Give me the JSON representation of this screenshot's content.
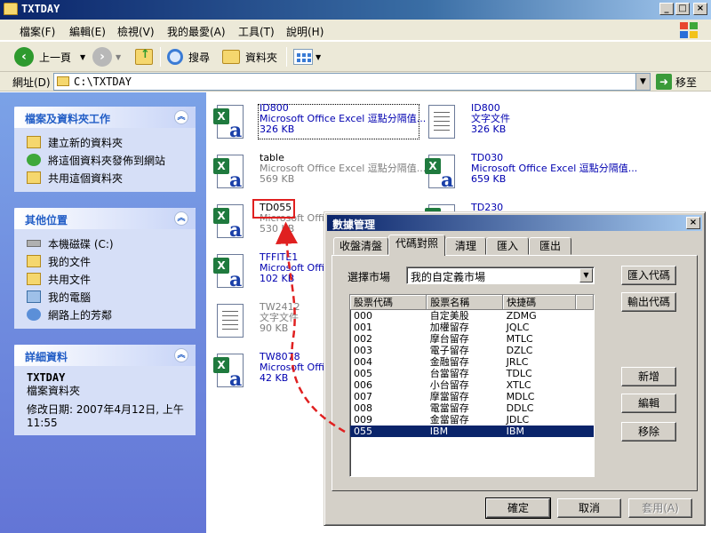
{
  "window": {
    "title": "TXTDAY"
  },
  "menu": [
    "檔案(F)",
    "編輯(E)",
    "檢視(V)",
    "我的最愛(A)",
    "工具(T)",
    "說明(H)"
  ],
  "toolbar": {
    "back": "上一頁",
    "search": "搜尋",
    "folders": "資料夾"
  },
  "address": {
    "label": "網址(D)",
    "value": "C:\\TXTDAY",
    "go": "移至"
  },
  "taskpane": {
    "file_tasks": {
      "title": "檔案及資料夾工作",
      "items": [
        "建立新的資料夾",
        "將這個資料夾發佈到網站",
        "共用這個資料夾"
      ]
    },
    "other_places": {
      "title": "其他位置",
      "items": [
        "本機磁碟 (C:)",
        "我的文件",
        "共用文件",
        "我的電腦",
        "網路上的芳鄰"
      ]
    },
    "details": {
      "title": "詳細資料",
      "name": "TXTDAY",
      "type": "檔案資料夾",
      "modified": "修改日期: 2007年4月12日, 上午 11:55"
    }
  },
  "files": [
    {
      "name": "ID800",
      "type": "Microsoft Office Excel 逗點分隔值...",
      "size": "326 KB",
      "kind": "excel"
    },
    {
      "name": "ID800",
      "type": "文字文件",
      "size": "326 KB",
      "kind": "text"
    },
    {
      "name": "table",
      "type": "Microsoft Office Excel 逗點分隔值...",
      "size": "569 KB",
      "kind": "excel"
    },
    {
      "name": "TD030",
      "type": "Microsoft Office Excel 逗點分隔值...",
      "size": "659 KB",
      "kind": "excel"
    },
    {
      "name": "TD055",
      "type": "Microsoft Office Excel 逗點分隔值...",
      "size": "530 KB",
      "kind": "excel"
    },
    {
      "name": "TD230",
      "type": "",
      "size": "",
      "kind": "excel"
    },
    {
      "name": "TFFITE1",
      "type": "Microsoft Office Excel 逗點分隔值...",
      "size": "102 KB",
      "kind": "excel"
    },
    {
      "name": "TW2412",
      "type": "文字文件",
      "size": "90 KB",
      "kind": "text"
    },
    {
      "name": "TW8078",
      "type": "Microsoft Office Excel 逗點分隔值...",
      "size": "42 KB",
      "kind": "excel"
    }
  ],
  "dialog": {
    "title": "數據管理",
    "tabs": [
      "收盤清盤",
      "代碼對照",
      "清理",
      "匯入",
      "匯出"
    ],
    "active_tab": 1,
    "market_label": "選擇市場",
    "market_value": "我的自定義市場",
    "columns": [
      "股票代碼",
      "股票名稱",
      "快捷碼"
    ],
    "rows": [
      [
        "000",
        "自定美股",
        "ZDMG"
      ],
      [
        "001",
        "加權留存",
        "JQLC"
      ],
      [
        "002",
        "摩台留存",
        "MTLC"
      ],
      [
        "003",
        "電子留存",
        "DZLC"
      ],
      [
        "004",
        "金融留存",
        "JRLC"
      ],
      [
        "005",
        "台當留存",
        "TDLC"
      ],
      [
        "006",
        "小台留存",
        "XTLC"
      ],
      [
        "007",
        "摩當留存",
        "MDLC"
      ],
      [
        "008",
        "電當留存",
        "DDLC"
      ],
      [
        "009",
        "金當留存",
        "JDLC"
      ],
      [
        "055",
        "IBM",
        "IBM"
      ]
    ],
    "selected_row": 10,
    "buttons": {
      "import_code": "匯入代碼",
      "export_code": "輸出代碼",
      "add": "新增",
      "edit": "編輯",
      "remove": "移除",
      "ok": "確定",
      "cancel": "取消",
      "apply": "套用(A)"
    }
  },
  "colors": {
    "title_blue": "#0a246a",
    "taskpane_blue": "#6375d6",
    "annotation_red": "#e02020",
    "selection": "#0a246a"
  }
}
